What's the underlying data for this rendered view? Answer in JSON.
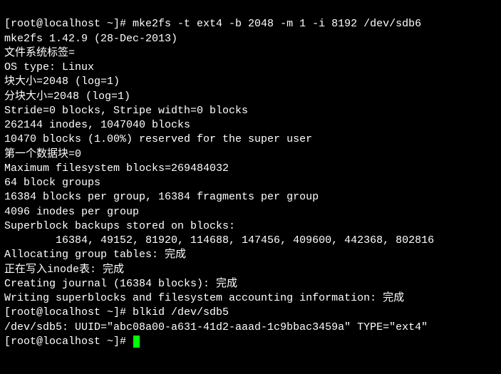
{
  "lines": [
    "[root@localhost ~]# mke2fs -t ext4 -b 2048 -m 1 -i 8192 /dev/sdb6",
    "mke2fs 1.42.9 (28-Dec-2013)",
    "文件系统标签=",
    "OS type: Linux",
    "块大小=2048 (log=1)",
    "分块大小=2048 (log=1)",
    "Stride=0 blocks, Stripe width=0 blocks",
    "262144 inodes, 1047040 blocks",
    "10470 blocks (1.00%) reserved for the super user",
    "第一个数据块=0",
    "Maximum filesystem blocks=269484032",
    "64 block groups",
    "16384 blocks per group, 16384 fragments per group",
    "4096 inodes per group",
    "Superblock backups stored on blocks:",
    "        16384, 49152, 81920, 114688, 147456, 409600, 442368, 802816",
    "",
    "Allocating group tables: 完成",
    "正在写入inode表: 完成",
    "Creating journal (16384 blocks): 完成",
    "Writing superblocks and filesystem accounting information: 完成",
    "",
    "[root@localhost ~]# blkid /dev/sdb5",
    "/dev/sdb5: UUID=\"abc08a00-a631-41d2-aaad-1c9bbac3459a\" TYPE=\"ext4\"",
    "[root@localhost ~]# "
  ],
  "prompt_indices": [
    0,
    22,
    24
  ],
  "cursor_line": 24
}
